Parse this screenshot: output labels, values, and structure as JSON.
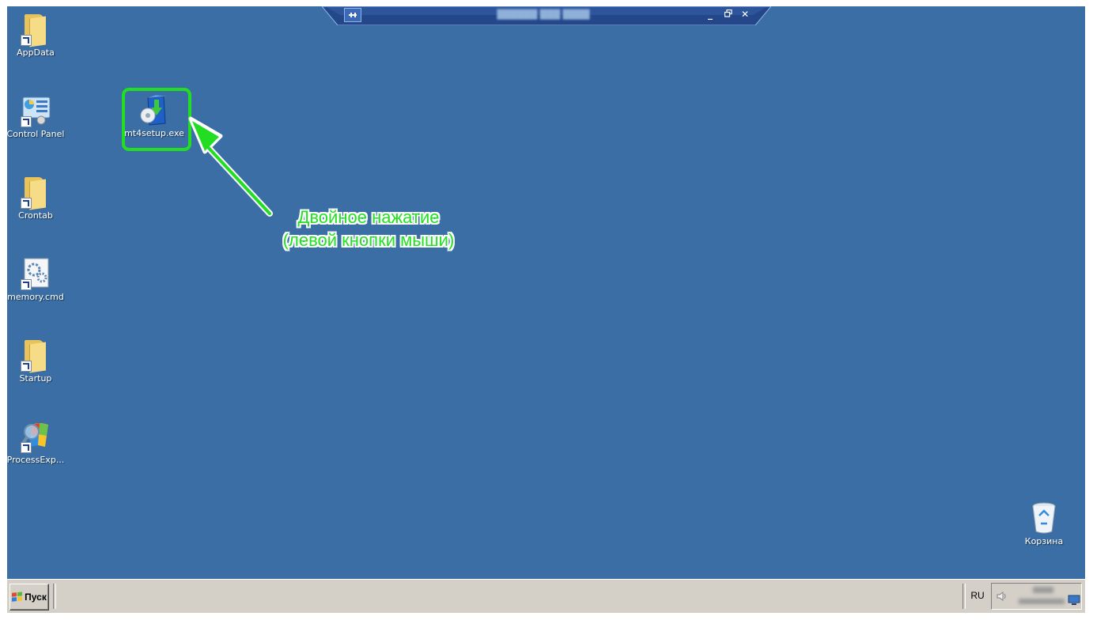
{
  "desktop": {
    "icons": [
      {
        "label": "AppData",
        "icon": "folder-shortcut-icon"
      },
      {
        "label": "Control Panel",
        "icon": "control-panel-icon"
      },
      {
        "label": "Crontab",
        "icon": "folder-shortcut-icon"
      },
      {
        "label": "memory.cmd",
        "icon": "cmd-script-icon"
      },
      {
        "label": "Startup",
        "icon": "folder-shortcut-icon"
      },
      {
        "label": "ProcessExp...",
        "icon": "process-explorer-icon"
      },
      {
        "label": "mt4setup.exe",
        "icon": "installer-icon"
      },
      {
        "label": "Корзина",
        "icon": "recycle-bin-icon"
      }
    ]
  },
  "annotation": {
    "line1": "Двойное нажатие",
    "line2": "(левой кнопки мыши)",
    "color": "#22dd22"
  },
  "rdp_bar": {
    "pin": "pin-icon",
    "minimize": "_",
    "restore": "restore-icon",
    "close": "✕"
  },
  "taskbar": {
    "start_label": "Пуск",
    "language": "RU"
  },
  "colors": {
    "desktop_bg": "#3a6ea5",
    "taskbar_bg": "#d4d0c8",
    "highlight": "#22dd22"
  }
}
